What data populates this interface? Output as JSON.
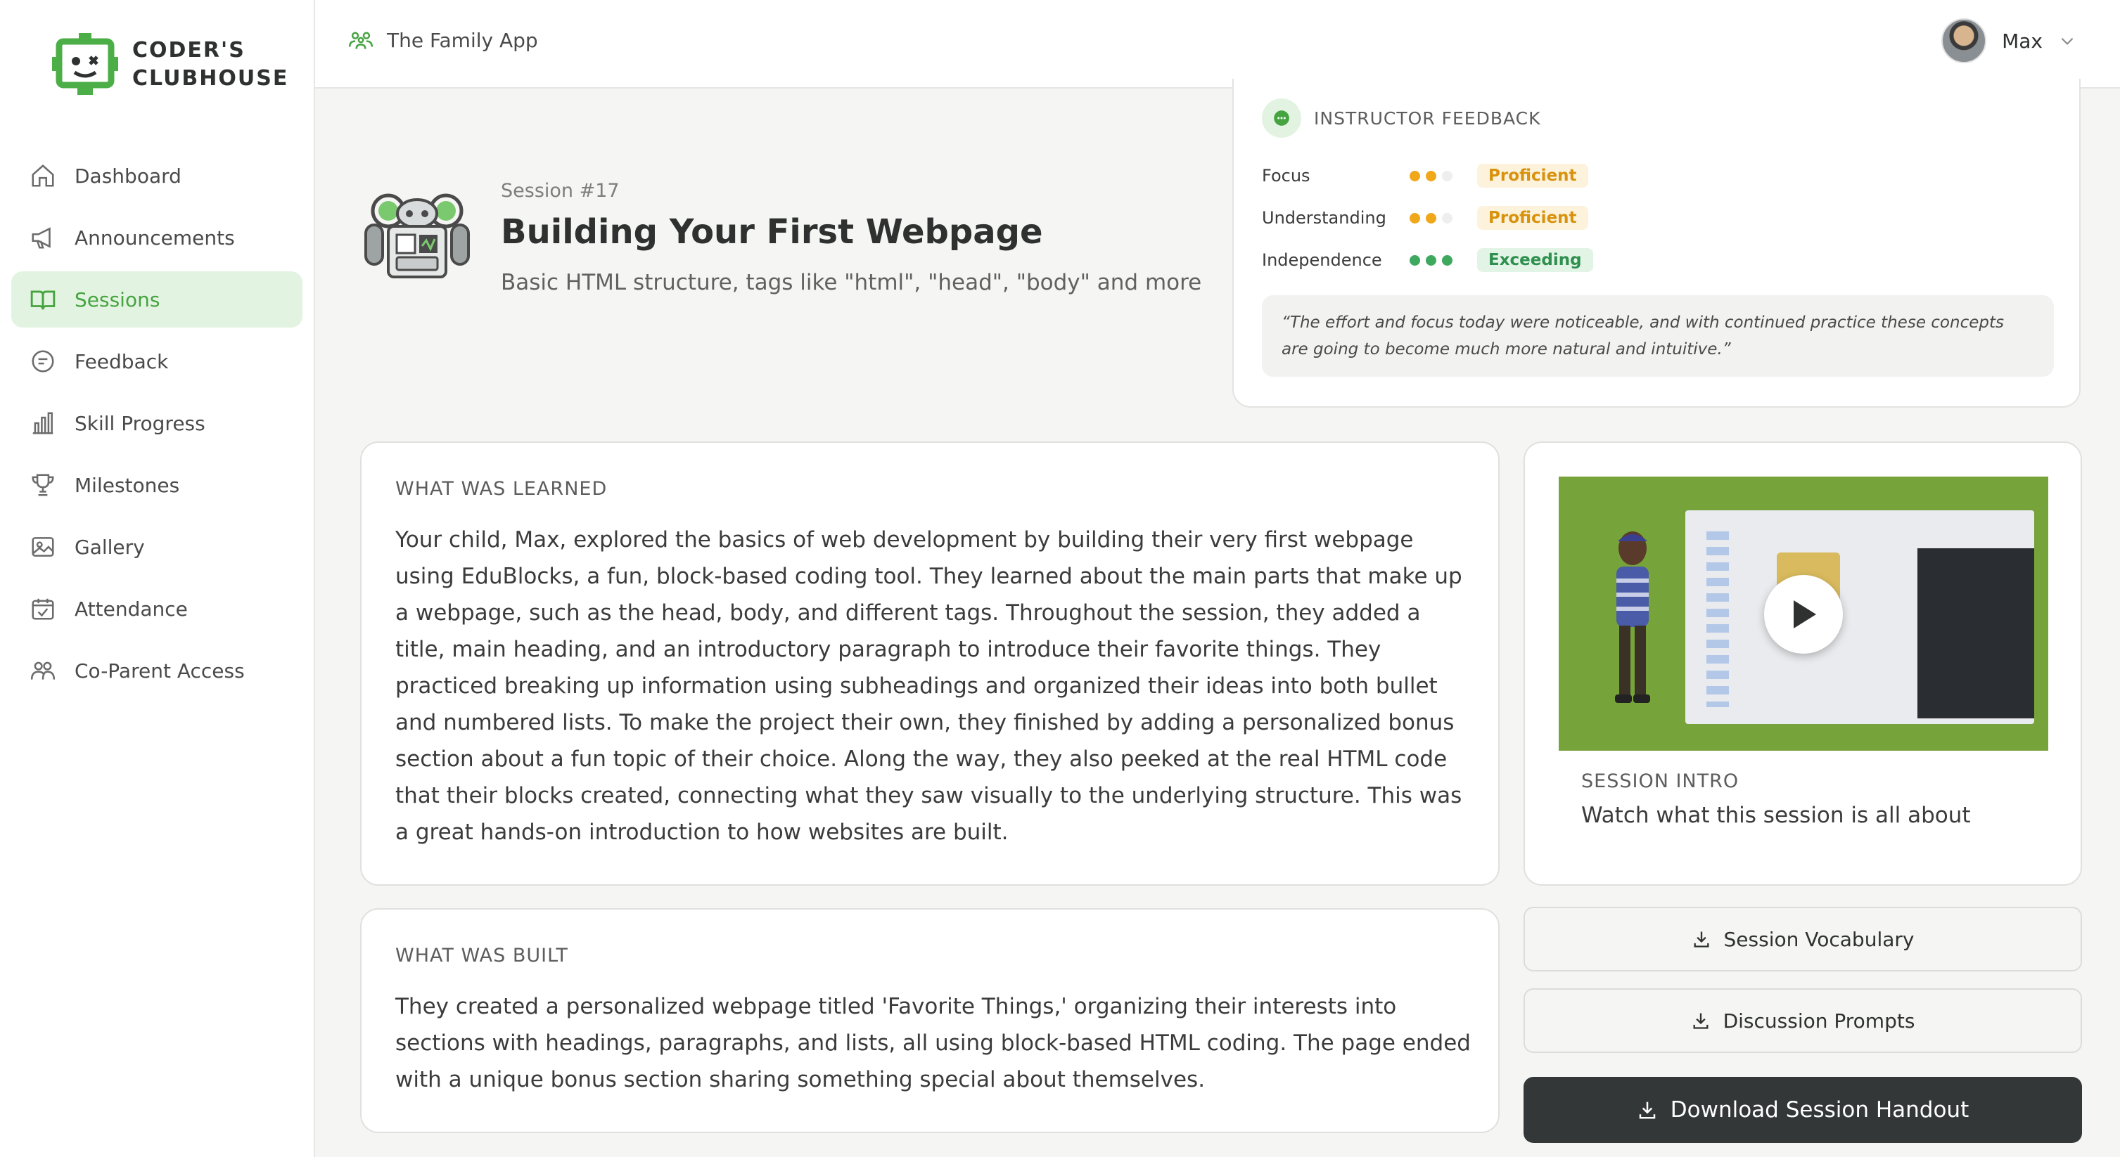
{
  "logo": {
    "line1": "CODER'S",
    "line2": "CLUBHOUSE"
  },
  "sidebar": {
    "items": [
      {
        "label": "Dashboard",
        "icon": "home-icon"
      },
      {
        "label": "Announcements",
        "icon": "megaphone-icon"
      },
      {
        "label": "Sessions",
        "icon": "book-icon",
        "active": true
      },
      {
        "label": "Feedback",
        "icon": "chat-icon"
      },
      {
        "label": "Skill Progress",
        "icon": "bar-chart-icon"
      },
      {
        "label": "Milestones",
        "icon": "trophy-icon"
      },
      {
        "label": "Gallery",
        "icon": "image-icon"
      },
      {
        "label": "Attendance",
        "icon": "calendar-check-icon"
      },
      {
        "label": "Co-Parent Access",
        "icon": "users-icon"
      }
    ]
  },
  "topbar": {
    "app_name": "The Family App",
    "user_name": "Max"
  },
  "session": {
    "number": "Session #17",
    "title": "Building Your First Webpage",
    "subtitle": "Basic HTML structure, tags like \"html\", \"head\", \"body\" and more"
  },
  "feedback": {
    "title": "INSTRUCTOR FEEDBACK",
    "rows": [
      {
        "label": "Focus",
        "level": 2,
        "max": 3,
        "badge": "Proficient"
      },
      {
        "label": "Understanding",
        "level": 2,
        "max": 3,
        "badge": "Proficient"
      },
      {
        "label": "Independence",
        "level": 3,
        "max": 3,
        "badge": "Exceeding"
      }
    ],
    "quote": "“The effort and focus today were noticeable, and with continued practice these concepts are going to become much more natural and intuitive.”"
  },
  "learned": {
    "label": "WHAT WAS LEARNED",
    "body": "Your child, Max, explored the basics of web development by building their very first webpage using EduBlocks, a fun, block-based coding tool. They learned about the main parts that make up a webpage, such as the head, body, and different tags. Throughout the session, they added a title, main heading, and an introductory paragraph to introduce their favorite things. They practiced breaking up information using subheadings and organized their ideas into both bullet and numbered lists. To make the project their own, they finished by adding a personalized bonus section about a fun topic of their choice. Along the way, they also peeked at the real HTML code that their blocks created, connecting what they saw visually to the underlying structure. This was a great hands-on introduction to how websites are built."
  },
  "built": {
    "label": "WHAT WAS BUILT",
    "body": "They created a personalized webpage titled 'Favorite Things,' organizing their interests into sections with headings, paragraphs, and lists, all using block-based HTML coding. The page ended with a unique bonus section sharing something special about themselves."
  },
  "video": {
    "label": "SESSION INTRO",
    "subtitle": "Watch what this session is all about"
  },
  "buttons": {
    "vocabulary": "Session Vocabulary",
    "prompts": "Discussion Prompts",
    "handout": "Download Session Handout"
  },
  "colors": {
    "accent": "#45a440",
    "proficient": "#f0a81a",
    "exceeding": "#3fa85f",
    "dark_button": "#333738"
  }
}
